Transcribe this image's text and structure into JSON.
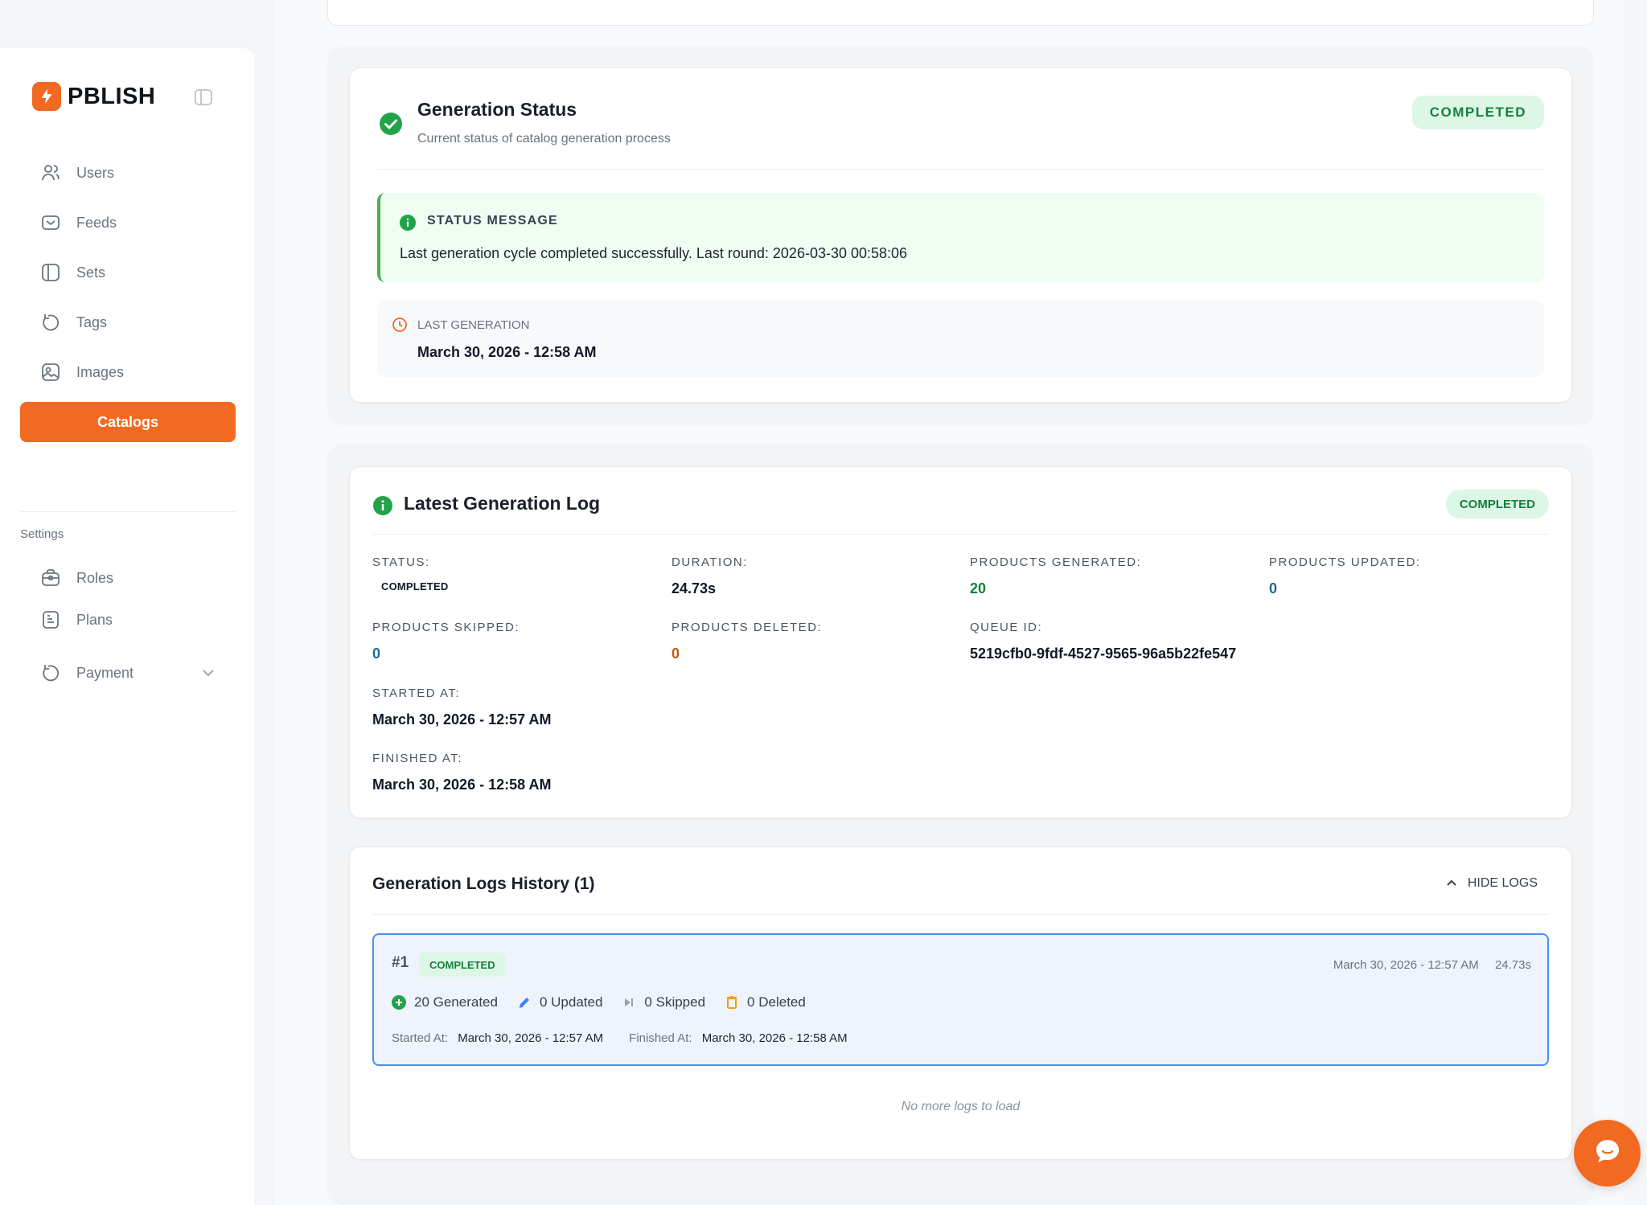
{
  "brand": {
    "name": "PBLISH"
  },
  "sidebar": {
    "items": [
      {
        "label": "Users",
        "icon": "users-icon"
      },
      {
        "label": "Feeds",
        "icon": "mail-icon"
      },
      {
        "label": "Sets",
        "icon": "panel-icon"
      },
      {
        "label": "Tags",
        "icon": "refresh-icon"
      },
      {
        "label": "Images",
        "icon": "image-icon"
      },
      {
        "label": "Catalogs",
        "icon": "catalog-icon",
        "active": true
      }
    ],
    "settings_heading": "Settings",
    "settings_items": [
      {
        "label": "Roles",
        "icon": "briefcase-icon"
      },
      {
        "label": "Plans",
        "icon": "document-icon"
      }
    ],
    "payment": {
      "label": "Payment",
      "icon": "refresh-icon"
    }
  },
  "status_card": {
    "title": "Generation Status",
    "subtitle": "Current status of catalog generation process",
    "badge": "COMPLETED",
    "message_heading": "STATUS MESSAGE",
    "message_text": "Last generation cycle completed successfully. Last round: 2026-03-30 00:58:06",
    "last_generation_label": "LAST GENERATION",
    "last_generation_value": "March 30, 2026 - 12:58 AM"
  },
  "latest_log": {
    "title": "Latest Generation Log",
    "badge": "COMPLETED",
    "fields": {
      "status": {
        "label": "STATUS:",
        "value": "COMPLETED"
      },
      "duration": {
        "label": "DURATION:",
        "value": "24.73s"
      },
      "products_generated": {
        "label": "PRODUCTS GENERATED:",
        "value": "20"
      },
      "products_updated": {
        "label": "PRODUCTS UPDATED:",
        "value": "0"
      },
      "products_skipped": {
        "label": "PRODUCTS SKIPPED:",
        "value": "0"
      },
      "products_deleted": {
        "label": "PRODUCTS DELETED:",
        "value": "0"
      },
      "queue_id": {
        "label": "QUEUE ID:",
        "value": "5219cfb0-9fdf-4527-9565-96a5b22fe547"
      },
      "started_at": {
        "label": "STARTED AT:",
        "value": "March 30, 2026 - 12:57 AM"
      },
      "finished_at": {
        "label": "FINISHED AT:",
        "value": "March 30, 2026 - 12:58 AM"
      }
    }
  },
  "history": {
    "title": "Generation Logs History (1)",
    "hide_label": "HIDE LOGS",
    "entries": [
      {
        "number": "#1",
        "status": "COMPLETED",
        "started_display": "March 30, 2026 - 12:57 AM",
        "duration": "24.73s",
        "generated": "20 Generated",
        "updated": "0 Updated",
        "skipped": "0 Skipped",
        "deleted": "0 Deleted",
        "started_label": "Started At:",
        "started_value": "March 30, 2026 - 12:57 AM",
        "finished_label": "Finished At:",
        "finished_value": "March 30, 2026 - 12:58 AM"
      }
    ],
    "empty_text": "No more logs to load"
  },
  "colors": {
    "accent": "#f26a22",
    "success": "#15803d",
    "success_bg": "#dcf7e5",
    "info_blue": "#4a8ff0"
  }
}
